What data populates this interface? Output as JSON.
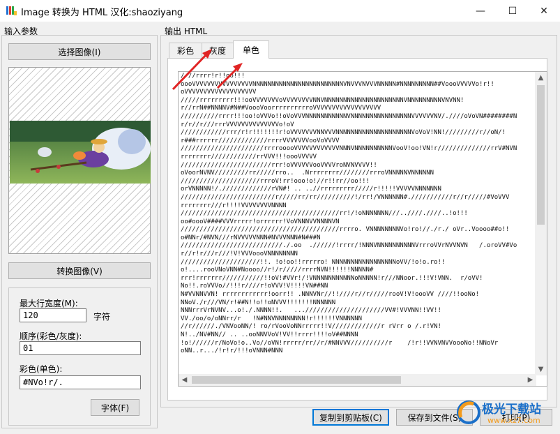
{
  "window": {
    "title": "Image 转换为 HTML   汉化:shaoziyang",
    "controls": {
      "minimize": "—",
      "maximize": "☐",
      "close": "✕"
    }
  },
  "left_panel": {
    "input_group_label": "输入参数",
    "select_image_button": "选择图像(I)",
    "convert_image_button": "转换图像(V)",
    "max_width_label": "最大行宽度(M):",
    "max_width_value": "120",
    "max_width_unit": "字符",
    "order_label": "顺序(彩色/灰度):",
    "order_value": "01",
    "mono_label": "彩色(单色):",
    "mono_value": "#NVo!r/.",
    "font_button": "字体(F)"
  },
  "right_panel": {
    "output_group_label": "输出 HTML",
    "tabs": [
      {
        "label": "彩色",
        "active": false
      },
      {
        "label": "灰度",
        "active": false
      },
      {
        "label": "单色",
        "active": true
      }
    ],
    "ascii_lines": [
      "////rrrr!r!!oo!!!",
      "oooVVVVVVVVVVVVVVVVNNNNNNNNNNNNNNNNNNNNNNNNVNVVVNVVVNNNNN#NNNNNNNNN##VoooVVVVVo!r!!",
      "oVVVVVVVVVVVVVVVVVVV",
      "/////rrrrrrrrr!!!ooVVVVVVVoVVVVVVVVNNVNNNNNNNNNNNNNNNNNNNNNVNNNNNNNNNVNVNN!",
      "r//rrN##NNNNV#N##VoooVoorrrrrrrrrroVVVVVVVVVVVVVVVVVV",
      "//////////rrrr!!!oo!oVVVo!!oVoVVVNNNNNNNNNNNVNNNNNNNNNNNNNNNNVVVVVVNV/.////oVoVN########N",
      "r/r//r///rrrVVVVVVVVVVVVVVo!oV",
      "////////////rrr/r!r!!!!!!!r!oVVVVVVVNNVVVNNNNNNNNNNNNNNNNNNNNVoVoV!NN!/////////r//oN/!",
      "r###rrrrrr/////////////rrrrVVVVVVVooVoVVVV",
      "//////////////////////rrrrooooVVVVVVVVVVVVNNNVNNNNNNNNNNVooV!oo!VN!r//////////////rrV#NVN",
      "rrrrrrrr////////////rrVVV!!!oooVVVVV",
      "////////////////////////rrr!oVVVVVVooVVVVroNVNVVVV!!",
      "oVoorNVNV/////////rr/////rro..  .Nrrrrrrrr////////rrroVNNNNNVNNNNNN",
      "/////////////////////rrroV!rr!ooo!o!//r!!rr//oo!!!",
      "orVNNNNN!/./////////////rVN#! .. ..//rrrrrrrrr/////r!!!!!VVVVVNNNNNNN",
      "/////////////////////////r/////rr/rr//////////!/rr!/VNNNNNN#.///////////r//r/////#VoVVV",
      "rrrrrrrr///r!!!!VVVVVVVVNNNN",
      "//////////////////////////////////////////rr!/!oNNNNNNN///..////.////..!o!!!",
      "oo#oooV####VVVrrrrr!orrrrrr!VoVNNNVVNNNNVN",
      "//////////////////////////////////////////rrrro. VNNNNNNNNVo!ro!//./r./ oVr..Voooo##o!!",
      "o#NNr/#NVN///rNVVVVVNNN#NVVVNNN#N###N",
      "///////////////////////////./.oo  .//////!rrrr/!NNNVNNNNNNNNNNVrrroVVrNVVNVN   /.oroVV#Vo",
      "r//r!r///r///!V!VVVoooVNNNNNNNN",
      "/////////////////////!!. !o!oo!!rrrrro! NNNNNNNNNNNNNNNNNoVV/!o!o.ro!!",
      "o!....rooVNoVNN#Noooo//r!/r/////rrrrNVN!!!!!!NNNNN#",
      "rrr!rrrrrrr///////////!!oV!#VVr!/!VNNNNNNNNNNNoNNNNN!r///NNoor.!!!V!VNN.  r/oVV!",
      "No!!.roVVVo//!!!r////r!oVVV!V!!!!VN##NN",
      "N#VVNNVVN! rrrrrrrrrrrr!oorr!! .NNNVNr//!!////r//r/////rooV!V!oooVV ////!!ooNo!",
      "NNoV./r///VN/r!##N!!o!!oNVVV!!!!!!!NNNNNN",
      "NNNrrrVrNVNV...o!./.NNNN!!.   .../////////////////////VV#!VVVNN!!VV!!",
      "VV./oo/o/oNNrr/r   !N#NNVNNNNNNNN!r!!!!!!VNNNNNN",
      "//r//////./VNVooNN/! ro/rVooVoNNrrrrr!!V/////////////r rVrr o /.r!VN!",
      "N!../NV#NN// .. ..ooNNVVoV!VV!!rrrr!!!!oV##NNNN",
      "!o!//////r/NoVo!o..Vo//oVN!rrrrr/rr//r/#NNVVV//////////r    /!r!!VVNVNVVoooNo!!NNoVr",
      "oNN..r.../!r!r/!!!oVNNN#NNN"
    ]
  },
  "buttons": {
    "copy": "复制到剪贴板(C)",
    "save": "保存到文件(S)",
    "print": "打印(P)"
  },
  "watermark": {
    "brand": "极光下载站",
    "url": "www.xz7.com"
  },
  "colors": {
    "accent": "#0078d7",
    "annotation_arrow": "#e02424",
    "watermark_orange": "#f39b1c",
    "watermark_blue": "#1a6fc9"
  }
}
